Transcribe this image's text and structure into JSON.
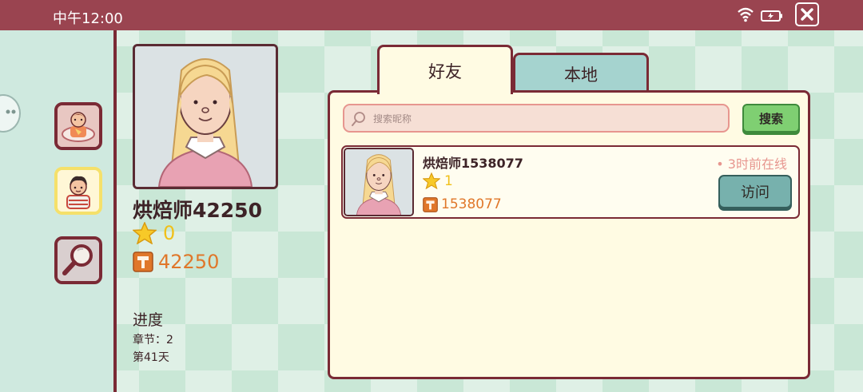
{
  "status_bar": {
    "time": "中午12:00"
  },
  "profile": {
    "name": "烘焙师42250",
    "stars": "0",
    "hammer_id": "42250",
    "progress_title": "进度",
    "chapter": "章节：2",
    "day": "第41天"
  },
  "tabs": [
    {
      "label": "好友",
      "active": true
    },
    {
      "label": "本地",
      "active": false
    }
  ],
  "search": {
    "placeholder": "搜索昵称",
    "button_label": "搜索"
  },
  "friends": [
    {
      "name": "烘焙师1538077",
      "stars": "1",
      "hammer_id": "1538077",
      "status": "• 3时前在线",
      "visit_label": "访问"
    }
  ],
  "colors": {
    "topbar": "#9a4450",
    "border": "#7a2a35",
    "panel": "#fffbe3",
    "accent_star": "#f0c019",
    "accent_orange": "#e0772a",
    "search_button": "#7fcf72",
    "visit_button": "#77b1ad"
  }
}
